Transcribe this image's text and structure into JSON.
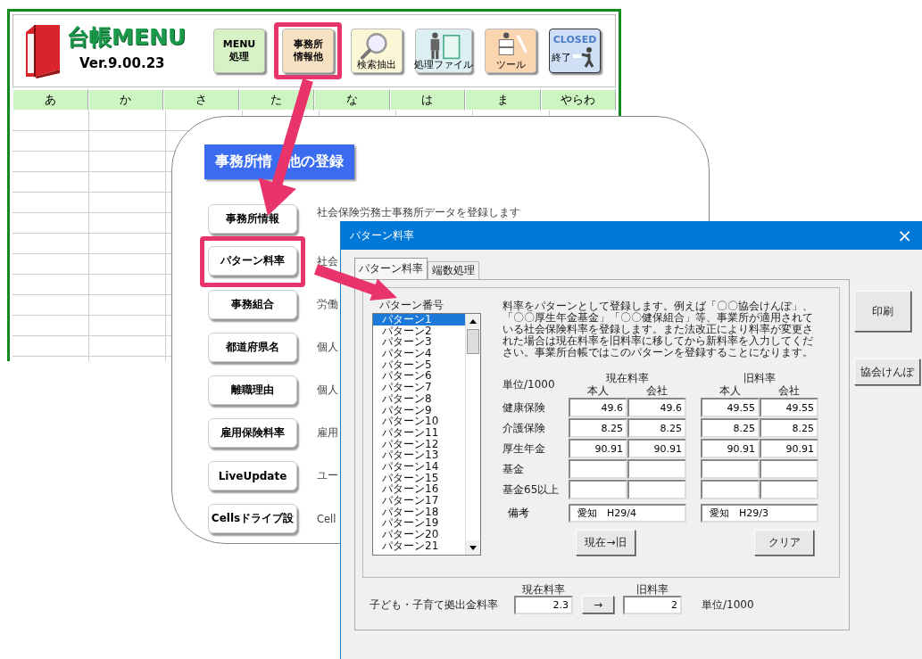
{
  "ledger_window": {
    "app_title": "台帳MENU",
    "version": "Ver.9.00.23",
    "toolbar_buttons": [
      {
        "kind": "text",
        "lines": [
          "MENU",
          "処理"
        ],
        "highlighted": false
      },
      {
        "kind": "text",
        "lines": [
          "事務所",
          "情報他"
        ],
        "highlighted": true
      },
      {
        "kind": "search",
        "lines": [
          "検索抽出"
        ],
        "highlighted": false
      },
      {
        "kind": "file",
        "lines": [
          "処理ファイル"
        ],
        "highlighted": false
      },
      {
        "kind": "tool",
        "lines": [
          "ツール"
        ],
        "highlighted": false
      },
      {
        "kind": "close",
        "lines": [
          "CLOSED",
          "終了"
        ],
        "highlighted": false
      }
    ],
    "kana_tabs": [
      "あ",
      "か",
      "さ",
      "た",
      "な",
      "は",
      "ま",
      "やらわ"
    ]
  },
  "registration_panel": {
    "title_parts": [
      "事務所情",
      "他の登録"
    ],
    "items": [
      {
        "label": "事務所情報",
        "description": "社会保険労務士事務所データを登録します",
        "highlighted": false
      },
      {
        "label": "パターン料率",
        "description": "社会",
        "highlighted": true
      },
      {
        "label": "事務組合",
        "description": "労働",
        "highlighted": false
      },
      {
        "label": "都道府県名",
        "description": "個人",
        "highlighted": false
      },
      {
        "label": "離職理由",
        "description": "個人",
        "highlighted": false
      },
      {
        "label": "雇用保険料率",
        "description": "雇用",
        "highlighted": false
      },
      {
        "label": "LiveUpdate",
        "description": "ユー",
        "highlighted": false
      },
      {
        "label": "Cellsドライブ設",
        "description": "Cell",
        "highlighted": false
      }
    ]
  },
  "dialog": {
    "title": "パターン料率",
    "close": "×",
    "tabs": [
      {
        "label": "パターン料率",
        "selected": true
      },
      {
        "label": "端数処理",
        "selected": false
      }
    ],
    "list_label": "パターン番号",
    "patterns": [
      {
        "label": "パターン1",
        "selected": true
      },
      {
        "label": "パターン2",
        "selected": false
      },
      {
        "label": "パターン3",
        "selected": false
      },
      {
        "label": "パターン4",
        "selected": false
      },
      {
        "label": "パターン5",
        "selected": false
      },
      {
        "label": "パターン6",
        "selected": false
      },
      {
        "label": "パターン7",
        "selected": false
      },
      {
        "label": "パターン8",
        "selected": false
      },
      {
        "label": "パターン9",
        "selected": false
      },
      {
        "label": "パターン10",
        "selected": false
      },
      {
        "label": "パターン11",
        "selected": false
      },
      {
        "label": "パターン12",
        "selected": false
      },
      {
        "label": "パターン13",
        "selected": false
      },
      {
        "label": "パターン14",
        "selected": false
      },
      {
        "label": "パターン15",
        "selected": false
      },
      {
        "label": "パターン16",
        "selected": false
      },
      {
        "label": "パターン17",
        "selected": false
      },
      {
        "label": "パターン18",
        "selected": false
      },
      {
        "label": "パターン19",
        "selected": false
      },
      {
        "label": "パターン20",
        "selected": false
      },
      {
        "label": "パターン21",
        "selected": false
      }
    ],
    "description": "料率をパターンとして登録します。例えば「〇〇協会けんぽ」、「〇〇厚生年金基金」「〇〇健保組合」等、事業所が適用されている社会保険料率を登録します。また法改正により料率が変更された場合は現在料率を旧料率に移してから新料率を入力してください。事業所台帳ではこのパターンを登録することになります。",
    "unit": "単位/1000",
    "group_headers": [
      "現在料率",
      "旧料率"
    ],
    "sub_headers": [
      "本人",
      "会社",
      "本人",
      "会社"
    ],
    "rows": [
      {
        "label": "健康保険",
        "values": [
          "49.6",
          "49.6",
          "49.55",
          "49.55"
        ]
      },
      {
        "label": "介護保険",
        "values": [
          "8.25",
          "8.25",
          "8.25",
          "8.25"
        ]
      },
      {
        "label": "厚生年金",
        "values": [
          "90.91",
          "90.91",
          "90.91",
          "90.91"
        ]
      },
      {
        "label": "基金"
      },
      {
        "label": "基金65以上"
      }
    ],
    "remarks": {
      "label": "備考",
      "values": [
        "愛知　H29/4",
        "愛知　H29/3"
      ]
    },
    "copy_button": "現在→旧",
    "clear_button": "クリア",
    "side_buttons": [
      "印刷",
      "協会けんぽ"
    ],
    "child_contribution": {
      "label": "子ども・子育て拠出金料率",
      "current_header": "現在料率",
      "current": "2.3",
      "arrow": "→",
      "old_header": "旧料率",
      "old": "2",
      "unit": "単位/1000"
    }
  }
}
